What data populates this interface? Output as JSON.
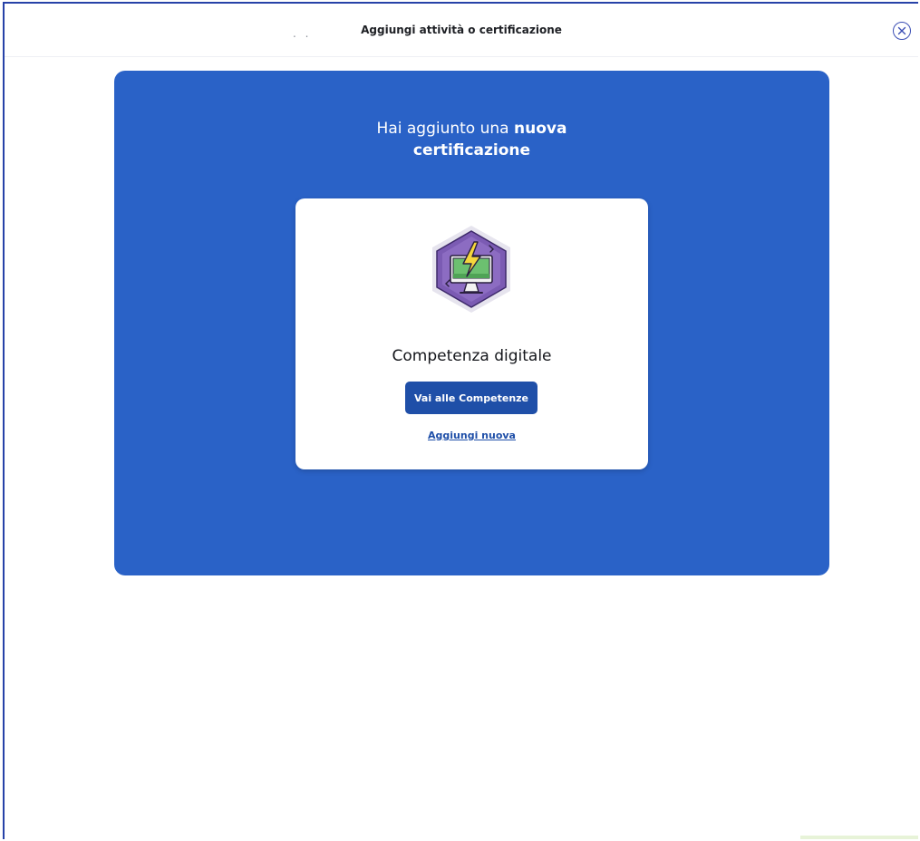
{
  "header": {
    "dots": ". .",
    "title": "Aggiungi attività o certificazione",
    "close_icon": "close-circle-icon"
  },
  "banner": {
    "title_regular": "Hai aggiunto una ",
    "title_bold_1": "nuova",
    "title_bold_2": "certificazione",
    "background": "#2a62c7"
  },
  "card": {
    "badge_icon": "digital-competence-badge-icon",
    "title": "Competenza digitale",
    "primary_button_label": "Vai alle Competenze",
    "secondary_link_label": "Aggiungi nuova"
  },
  "colors": {
    "accent": "#1f4fa8",
    "badge_purple": "#7b5bb3",
    "badge_green": "#6cc070",
    "bolt_yellow": "#f5d63d"
  }
}
